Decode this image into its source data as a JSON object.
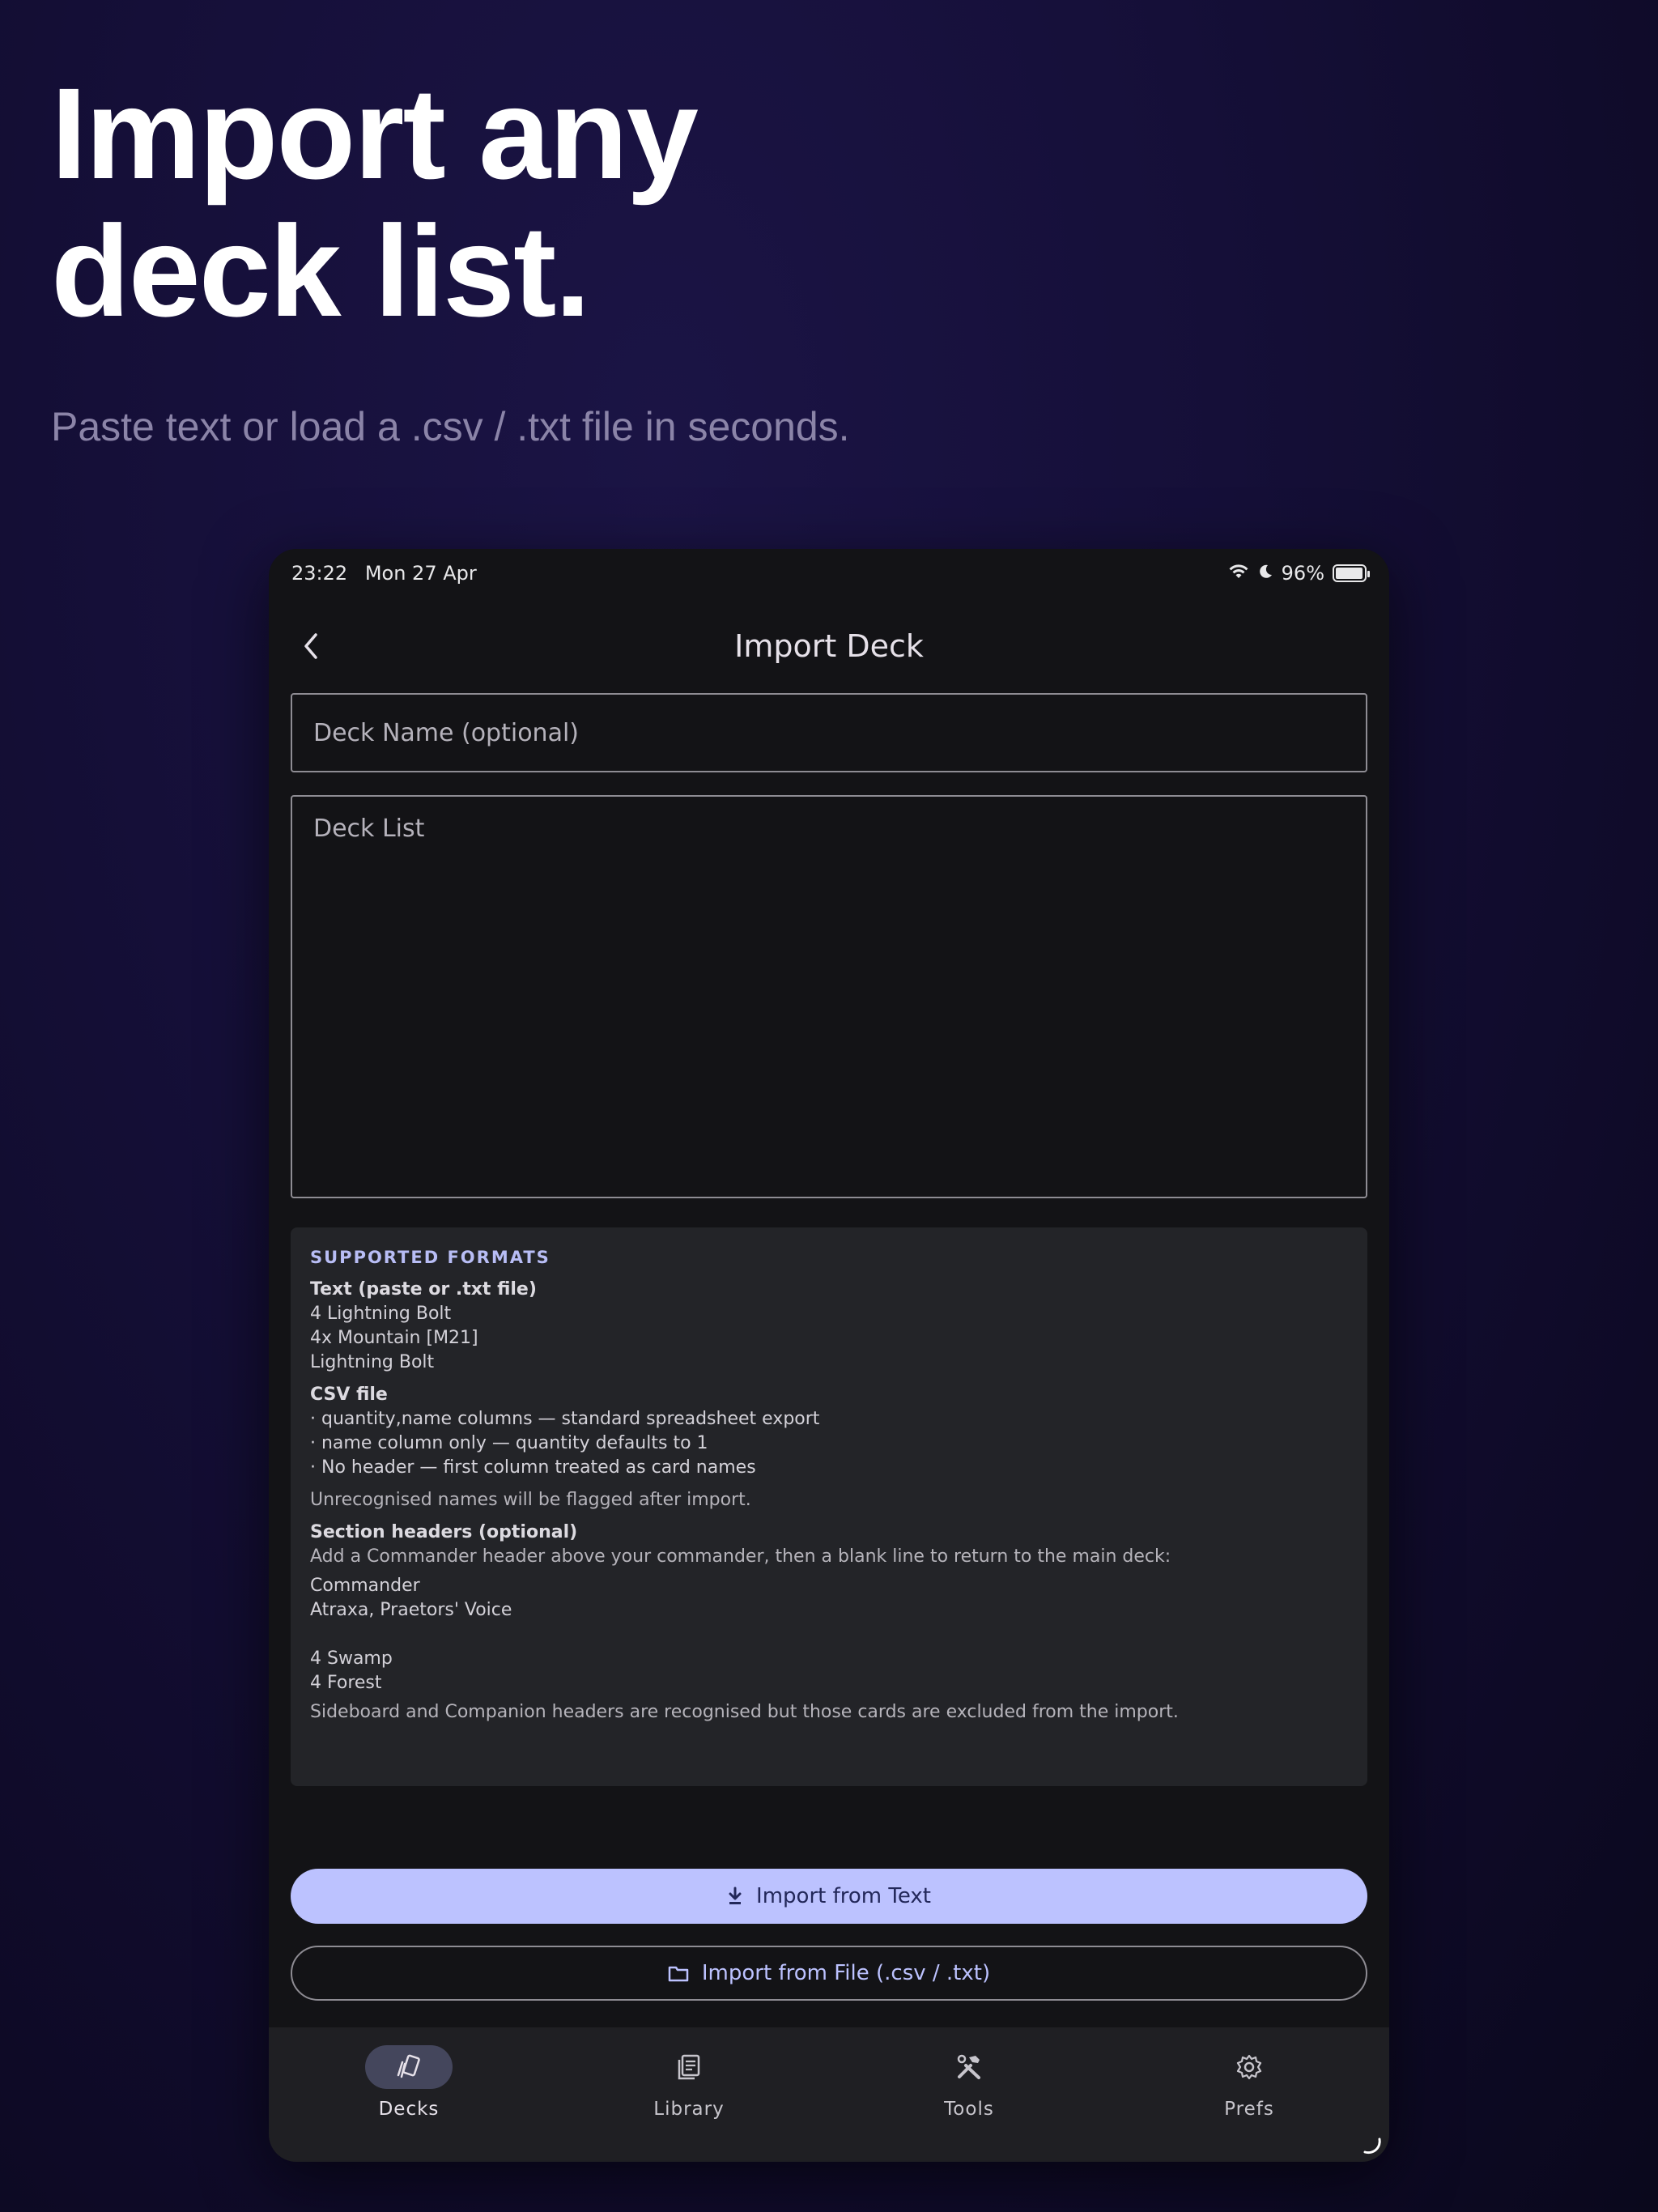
{
  "hero": {
    "title_line1": "Import any",
    "title_line2": "deck list.",
    "subtitle": "Paste text or load a .csv / .txt file in seconds."
  },
  "status_bar": {
    "time": "23:22",
    "date": "Mon 27 Apr",
    "battery": "96%",
    "battery_level": 0.96
  },
  "topbar": {
    "title": "Import Deck"
  },
  "form": {
    "deck_name_placeholder": "Deck Name (optional)",
    "deck_list_placeholder": "Deck List"
  },
  "formats": {
    "heading": "SUPPORTED FORMATS",
    "text_title": "Text (paste or .txt file)",
    "text_examples": [
      "4 Lightning Bolt",
      "4x Mountain [M21]",
      "Lightning Bolt"
    ],
    "csv_title": "CSV file",
    "csv_lines": [
      "· quantity,name columns — standard spreadsheet export",
      "· name column only — quantity defaults to 1",
      "· No header — first column treated as card names"
    ],
    "unrecognised_note": "Unrecognised names will be flagged after import.",
    "sections_title": "Section headers (optional)",
    "sections_desc": "Add a Commander header above your commander, then a blank line to return to the main deck:",
    "sections_example_1": [
      "Commander",
      "Atraxa, Praetors' Voice"
    ],
    "sections_example_2": [
      "4 Swamp",
      "4 Forest"
    ],
    "sideboard_note": "Sideboard and Companion headers are recognised but those cards are excluded from the import."
  },
  "actions": {
    "import_text_label": "Import from Text",
    "import_file_label": "Import from File (.csv / .txt)"
  },
  "nav": {
    "items": [
      {
        "label": "Decks",
        "icon": "cards-icon",
        "active": true
      },
      {
        "label": "Library",
        "icon": "library-icon",
        "active": false
      },
      {
        "label": "Tools",
        "icon": "tools-icon",
        "active": false
      },
      {
        "label": "Prefs",
        "icon": "gear-icon",
        "active": false
      }
    ]
  },
  "colors": {
    "accent": "#bcc2ff",
    "surface": "#131316",
    "card": "#232428"
  }
}
